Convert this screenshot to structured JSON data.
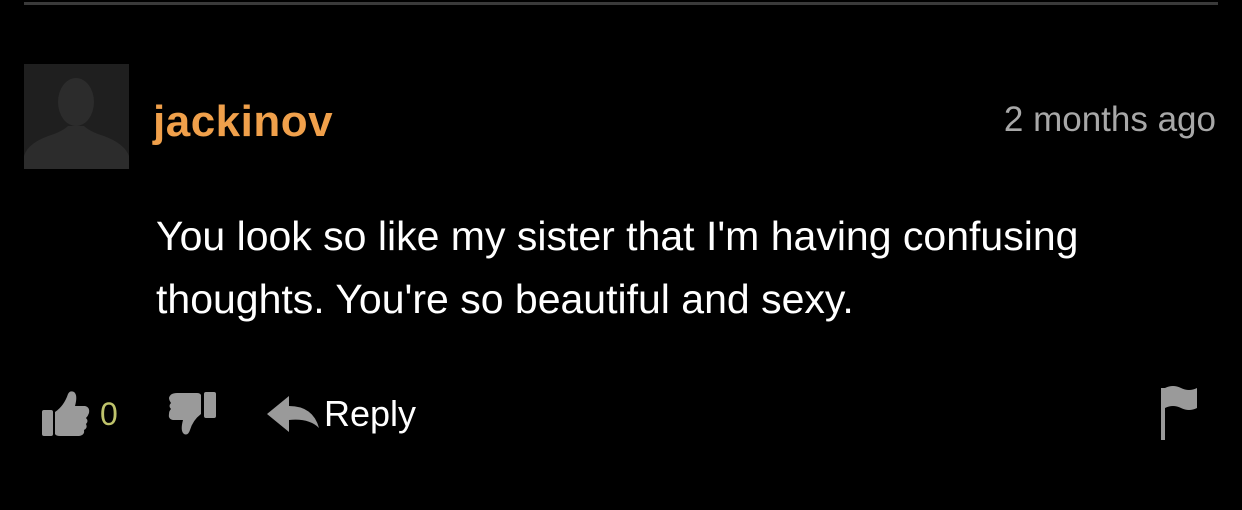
{
  "comment": {
    "username": "jackinov",
    "timestamp": "2 months ago",
    "text": "You look so like my sister that I'm having confusing thoughts. You're so beautiful and sexy.",
    "vote_count": "0",
    "reply_label": "Reply"
  },
  "icons": {
    "avatar": "default-user-silhouette",
    "thumb_up": "thumb-up-icon",
    "thumb_down": "thumb-down-icon",
    "reply": "reply-arrow-icon",
    "flag": "flag-icon"
  },
  "colors": {
    "background": "#000000",
    "username": "#f0a04b",
    "timestamp": "#a8a8a8",
    "text": "#ffffff",
    "vote_count": "#bfc36b",
    "icon": "#9a9a9a"
  }
}
